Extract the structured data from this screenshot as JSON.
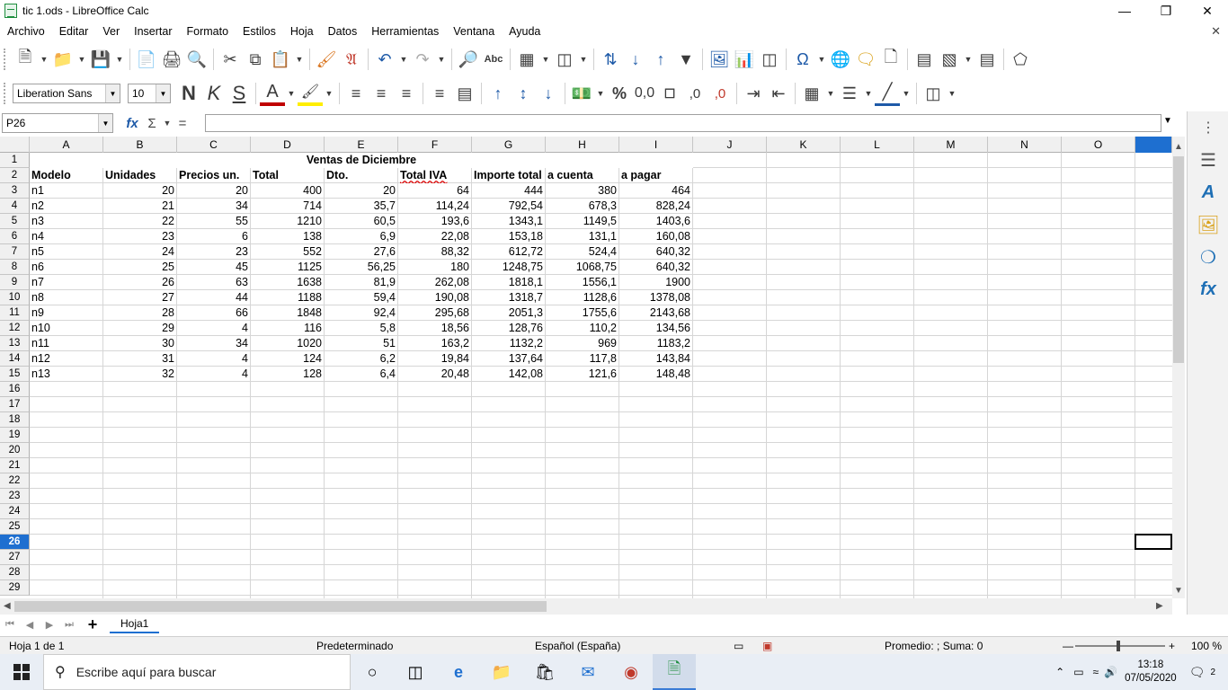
{
  "window": {
    "title": "tic 1.ods - LibreOffice Calc"
  },
  "menu": [
    "Archivo",
    "Editar",
    "Ver",
    "Insertar",
    "Formato",
    "Estilos",
    "Hoja",
    "Datos",
    "Herramientas",
    "Ventana",
    "Ayuda"
  ],
  "format_toolbar": {
    "font_name": "Liberation Sans",
    "font_size": "10"
  },
  "formula_bar": {
    "name_box": "P26",
    "content": ""
  },
  "columns": [
    "A",
    "B",
    "C",
    "D",
    "E",
    "F",
    "G",
    "H",
    "I",
    "J",
    "K",
    "L",
    "M",
    "N",
    "O"
  ],
  "rows": [
    "1",
    "2",
    "3",
    "4",
    "5",
    "6",
    "7",
    "8",
    "9",
    "10",
    "11",
    "12",
    "13",
    "14",
    "15",
    "16",
    "17",
    "18",
    "19",
    "20",
    "21",
    "22",
    "23",
    "24",
    "25",
    "26",
    "27",
    "28",
    "29"
  ],
  "selected": {
    "column": "P",
    "row": "26"
  },
  "sheet": {
    "title": "Ventas de Diciembre",
    "headers": [
      "Modelo",
      "Unidades",
      "Precios un.",
      "Total",
      "Dto.",
      "Total IVA",
      "Importe total",
      "a cuenta",
      "a pagar"
    ],
    "data": [
      [
        "n1",
        "20",
        "20",
        "400",
        "20",
        "64",
        "444",
        "380",
        "464"
      ],
      [
        "n2",
        "21",
        "34",
        "714",
        "35,7",
        "114,24",
        "792,54",
        "678,3",
        "828,24"
      ],
      [
        "n3",
        "22",
        "55",
        "1210",
        "60,5",
        "193,6",
        "1343,1",
        "1149,5",
        "1403,6"
      ],
      [
        "n4",
        "23",
        "6",
        "138",
        "6,9",
        "22,08",
        "153,18",
        "131,1",
        "160,08"
      ],
      [
        "n5",
        "24",
        "23",
        "552",
        "27,6",
        "88,32",
        "612,72",
        "524,4",
        "640,32"
      ],
      [
        "n6",
        "25",
        "45",
        "1125",
        "56,25",
        "180",
        "1248,75",
        "1068,75",
        "640,32"
      ],
      [
        "n7",
        "26",
        "63",
        "1638",
        "81,9",
        "262,08",
        "1818,1",
        "1556,1",
        "1900"
      ],
      [
        "n8",
        "27",
        "44",
        "1188",
        "59,4",
        "190,08",
        "1318,7",
        "1128,6",
        "1378,08"
      ],
      [
        "n9",
        "28",
        "66",
        "1848",
        "92,4",
        "295,68",
        "2051,3",
        "1755,6",
        "2143,68"
      ],
      [
        "n10",
        "29",
        "4",
        "116",
        "5,8",
        "18,56",
        "128,76",
        "110,2",
        "134,56"
      ],
      [
        "n11",
        "30",
        "34",
        "1020",
        "51",
        "163,2",
        "1132,2",
        "969",
        "1183,2"
      ],
      [
        "n12",
        "31",
        "4",
        "124",
        "6,2",
        "19,84",
        "137,64",
        "117,8",
        "143,84"
      ],
      [
        "n13",
        "32",
        "4",
        "128",
        "6,4",
        "20,48",
        "142,08",
        "121,6",
        "148,48"
      ]
    ]
  },
  "sheet_tabs": {
    "active": "Hoja1"
  },
  "status": {
    "sheet_pos": "Hoja 1 de 1",
    "page_style": "Predeterminado",
    "language": "Español (España)",
    "summary": "Promedio: ; Suma: 0",
    "zoom": "100 %"
  },
  "taskbar": {
    "search_placeholder": "Escribe aquí para buscar",
    "time": "13:18",
    "date": "07/05/2020",
    "notifications": "2"
  }
}
